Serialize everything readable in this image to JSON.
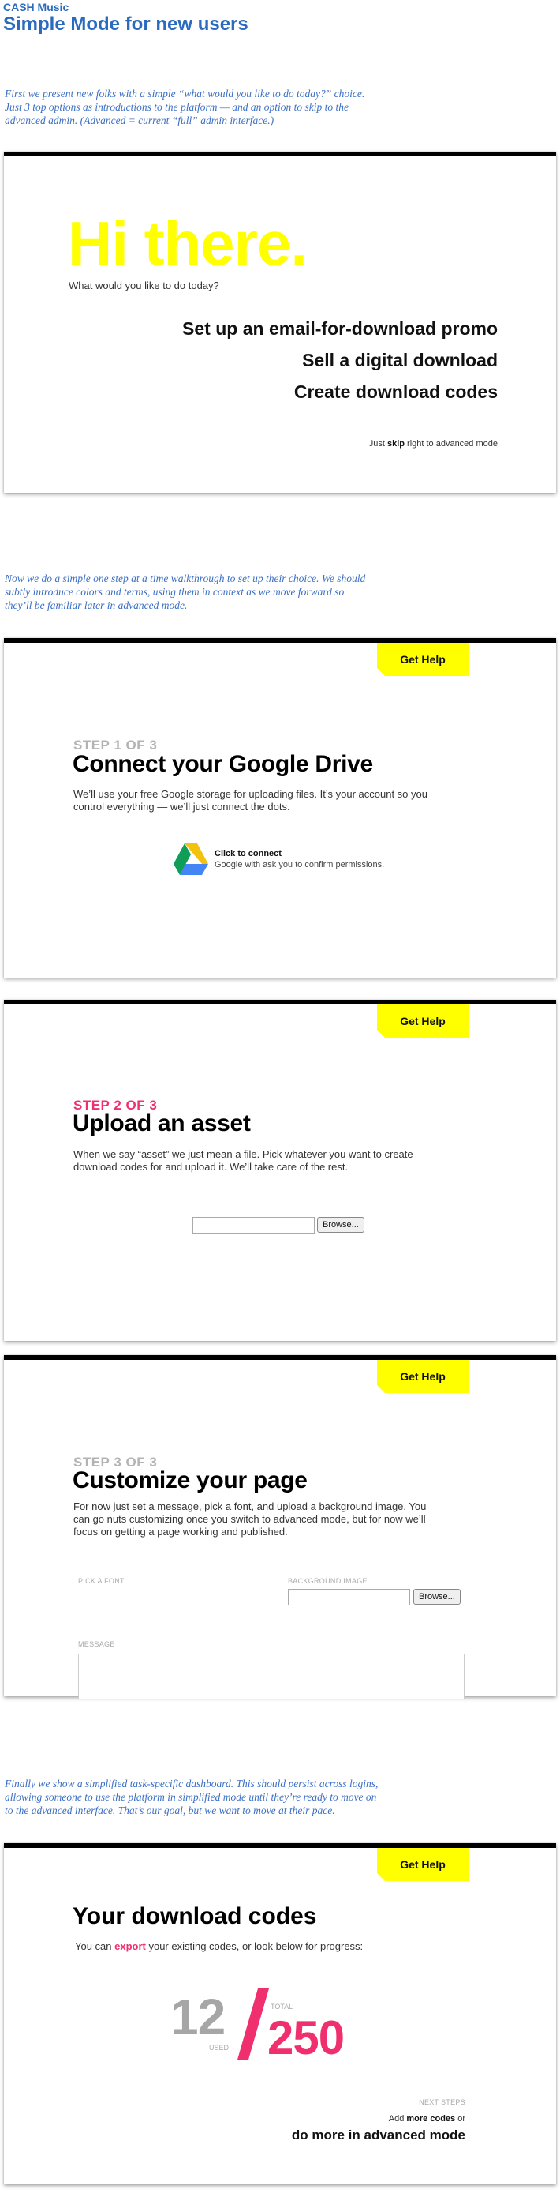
{
  "header": {
    "brand": "CASH Music",
    "title": "Simple Mode for new users"
  },
  "notes": {
    "intro": [
      "First we present new folks with a simple “what would you like to do today?” choice.",
      "Just 3 top options as introductions to the platform — and an option to skip to the",
      "advanced admin. (Advanced = current “full” admin interface.)"
    ],
    "walkthrough": [
      "Now we do a simple one step at a time walkthrough to set up their choice. We should",
      "subtly introduce colors and terms, using them in context as we move forward so",
      "they’ll be familiar later in advanced mode."
    ],
    "dashboard": [
      "Finally we show a simplified task-specific dashboard. This should persist across logins,",
      "allowing someone to use the platform in simplified mode until they’re ready to move on",
      "to the advanced interface. That’s our goal, but we want to move at their pace."
    ]
  },
  "welcome": {
    "greeting": "Hi there.",
    "question": "What would you like to do today?",
    "choices": [
      "Set up an email-for-download promo",
      "Sell a digital download",
      "Create download codes"
    ],
    "skip_prefix": "Just ",
    "skip_link": "skip",
    "skip_suffix": " right to advanced mode"
  },
  "help_label": "Get Help",
  "step1": {
    "label": "STEP 1 OF 3",
    "title": "Connect your Google Drive",
    "description": [
      "We’ll use your free Google storage for uploading files. It’s your account so you",
      "control everything — we’ll just connect the dots."
    ],
    "connect_title": "Click to connect",
    "connect_sub": "Google with ask you to confirm permissions."
  },
  "step2": {
    "label": "STEP 2 OF 3",
    "title": "Upload an asset",
    "description": [
      "When we say “asset” we just mean a file. Pick whatever you want to create",
      "download codes for and upload it. We’ll take care of the rest."
    ],
    "browse_label": "Browse..."
  },
  "step3": {
    "label": "STEP 3 OF 3",
    "title": "Customize your page",
    "description": [
      "For now just set a message, pick a font, and upload a background image. You",
      "can go nuts customizing once you switch to advanced mode, but for now we’ll",
      "focus on getting a page working and published."
    ],
    "font_label": "PICK A FONT",
    "bg_label": "BACKGROUND IMAGE",
    "browse_label": "Browse...",
    "message_label": "MESSAGE"
  },
  "dashboard": {
    "title": "Your download codes",
    "desc_prefix": "You can ",
    "desc_link": "export",
    "desc_suffix": " your existing codes, or look below for progress:",
    "used": "12",
    "used_label": "USED",
    "total": "250",
    "total_label": "TOTAL",
    "next_steps_label": "NEXT STEPS",
    "add_prefix": "Add ",
    "add_link": "more codes",
    "add_suffix": " or",
    "advanced_link": "do more in advanced mode"
  },
  "colors": {
    "note_blue": "#3b6fc4",
    "brand_blue": "#2a6bbf",
    "highlight_yellow": "#ffff00",
    "accent_pink": "#f0306e",
    "muted_gray": "#b3b3b3"
  }
}
